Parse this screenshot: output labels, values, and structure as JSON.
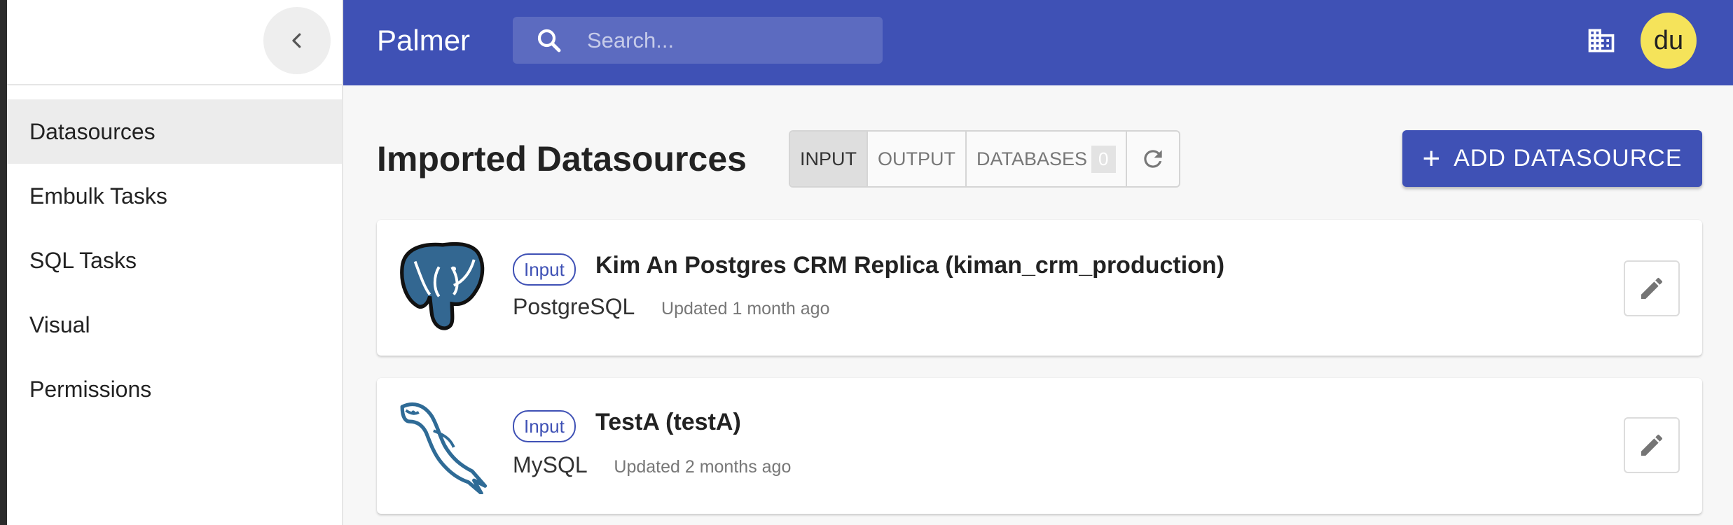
{
  "app": {
    "title": "Palmer"
  },
  "search": {
    "placeholder": "Search..."
  },
  "user": {
    "initials": "du"
  },
  "colors": {
    "primary": "#3f51b5",
    "avatar": "#f5e35a"
  },
  "sidebar": {
    "items": [
      {
        "label": "Datasources",
        "active": true
      },
      {
        "label": "Embulk Tasks"
      },
      {
        "label": "SQL Tasks"
      },
      {
        "label": "Visual"
      },
      {
        "label": "Permissions"
      }
    ]
  },
  "page": {
    "title": "Imported Datasources"
  },
  "filters": {
    "input_label": "INPUT",
    "output_label": "OUTPUT",
    "databases_label": "DATABASES",
    "databases_count": "0"
  },
  "add_button": {
    "label": "ADD DATASOURCE"
  },
  "datasources": [
    {
      "badge": "Input",
      "name": "Kim An Postgres CRM Replica (kiman_crm_production)",
      "type": "PostgreSQL",
      "updated": "Updated 1 month ago",
      "icon": "postgresql-elephant-icon"
    },
    {
      "badge": "Input",
      "name": "TestA (testA)",
      "type": "MySQL",
      "updated": "Updated 2 months ago",
      "icon": "mysql-dolphin-icon"
    }
  ]
}
